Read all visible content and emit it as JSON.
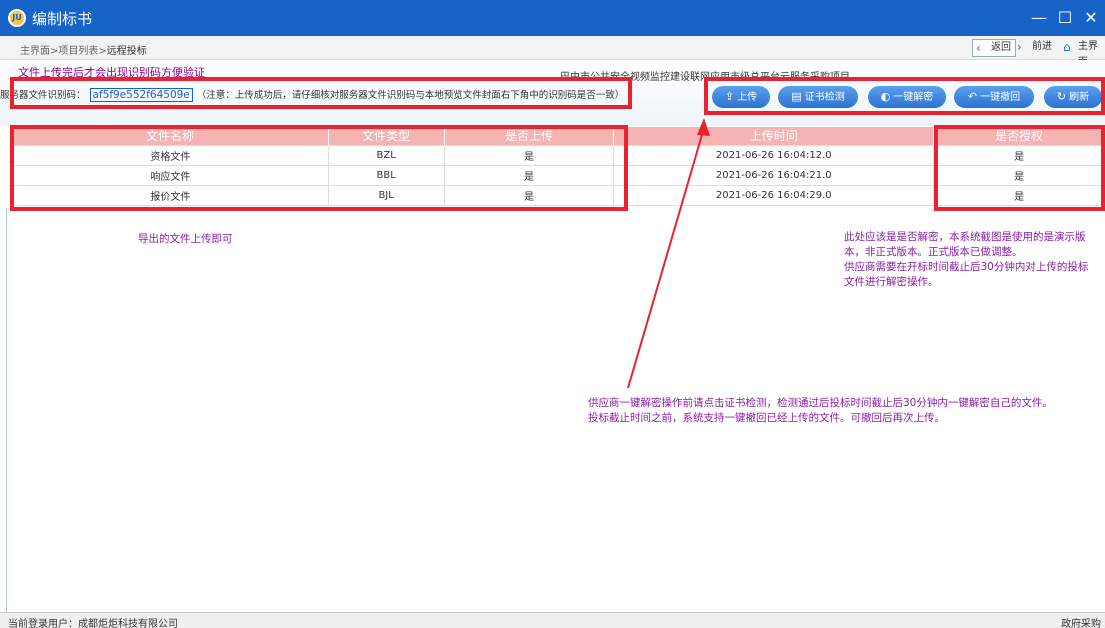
{
  "window": {
    "title": "编制标书",
    "logo_text": "JU",
    "minimize": "—",
    "maximize": "☐",
    "close": "✕"
  },
  "breadcrumb": {
    "home": "主界面",
    "sep1": ">",
    "list": "项目列表",
    "sep2": ">",
    "current": "远程投标"
  },
  "nav": {
    "back": "返回",
    "forward": "前进",
    "main": "主界面"
  },
  "info": {
    "hint": "文件上传完后才会出现识别码方便验证",
    "project_name": "巴中市公共安全视频监控建设联网应用市级总平台云服务采购项目",
    "code_label": "服务器文件识别码：",
    "code_value": "af5f9e552f64509e",
    "code_note": "（注意：上传成功后，请仔细核对服务器文件识别码与本地预览文件封面右下角中的识别码是否一致）"
  },
  "actions": [
    {
      "label": "上传",
      "icon": "upload-icon"
    },
    {
      "label": "证书检测",
      "icon": "certificate-icon"
    },
    {
      "label": "一键解密",
      "icon": "decrypt-icon"
    },
    {
      "label": "一键撤回",
      "icon": "undo-icon"
    },
    {
      "label": "刷新",
      "icon": "refresh-icon"
    }
  ],
  "table": {
    "headers": [
      "文件名称",
      "文件类型",
      "是否上传",
      "上传时间",
      "是否授权"
    ],
    "rows": [
      [
        "资格文件",
        "BZL",
        "是",
        "2021-06-26 16:04:12.0",
        "是"
      ],
      [
        "响应文件",
        "BBL",
        "是",
        "2021-06-26 16:04:21.0",
        "是"
      ],
      [
        "报价文件",
        "BJL",
        "是",
        "2021-06-26 16:04:29.0",
        "是"
      ]
    ]
  },
  "annotations": {
    "export_note": "导出的文件上传即可",
    "decrypt_note_1": "此处应该是是否解密，本系统截图是使用的是演示版",
    "decrypt_note_2": "本，非正式版本。正式版本已做调整。",
    "decrypt_note_3": "供应商需要在开标时间截止后30分钟内对上传的投标",
    "decrypt_note_4": "文件进行解密操作。",
    "check_note_1": "供应商一键解密操作前请点击证书检测，检测通过后投标时间截止后30分钟内一键解密自己的文件。",
    "check_note_2": "投标截止时间之前，系统支持一键撤回已经上传的文件。可撤回后再次上传。"
  },
  "status": {
    "user": "当前登录用户：成都炬炬科技有限公司",
    "right": "政府采购"
  },
  "colors": {
    "titlebar": "#1764c9",
    "annotation_red": "#e8232f",
    "note_purple": "#8b1fa8",
    "header_pink": "#f5b3b3"
  }
}
